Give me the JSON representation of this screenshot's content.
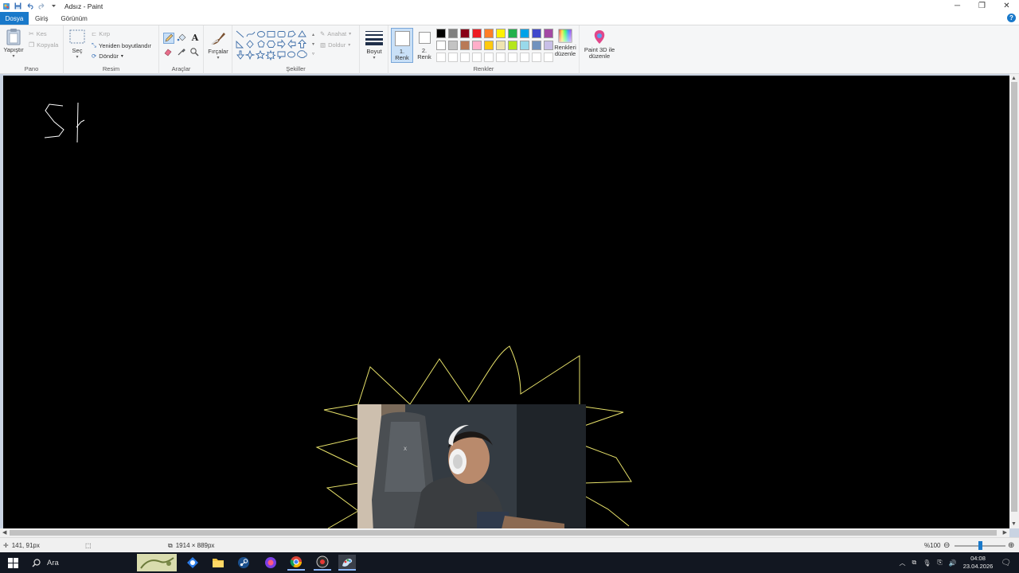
{
  "window": {
    "title": "Adsız - Paint",
    "minimize_glyph": "─",
    "maximize_glyph": "❐",
    "close_glyph": "✕"
  },
  "tabs": [
    {
      "label": "Dosya"
    },
    {
      "label": "Giriş"
    },
    {
      "label": "Görünüm"
    }
  ],
  "help": "?",
  "ribbon": {
    "pano": {
      "label": "Pano",
      "paste": "Yapıştır",
      "cut": "Kes",
      "copy": "Kopyala"
    },
    "resim": {
      "label": "Resim",
      "select": "Seç",
      "crop": "Kırp",
      "resize": "Yeniden boyutlandır",
      "rotate": "Döndür"
    },
    "araclar": {
      "label": "Araçlar"
    },
    "brushes": {
      "label": "Fırçalar"
    },
    "sekiller": {
      "label": "Şekiller",
      "outline": "Anahat",
      "fill": "Doldur"
    },
    "size": {
      "label": "Boyut"
    },
    "colors": {
      "label": "Renkler",
      "color1": "1. Renk",
      "color1_line1": "1.",
      "color1_line2": "Renk",
      "color2_line1": "2.",
      "color2_line2": "Renk",
      "edit_line1": "Renkleri",
      "edit_line2": "düzenle",
      "palette_row1": [
        "#000000",
        "#7f7f7f",
        "#880015",
        "#ed1c24",
        "#ff7f27",
        "#fff200",
        "#22b14c",
        "#00a2e8",
        "#3f48cc",
        "#a349a4"
      ],
      "palette_row2": [
        "#ffffff",
        "#c3c3c3",
        "#b97a57",
        "#ffaec9",
        "#ffc90e",
        "#efe4b0",
        "#b5e61d",
        "#99d9ea",
        "#7092be",
        "#c8bfe7"
      ],
      "palette_row3": [
        "#ffffff",
        "#ffffff",
        "#ffffff",
        "#ffffff",
        "#ffffff",
        "#ffffff",
        "#ffffff",
        "#ffffff",
        "#ffffff",
        "#ffffff"
      ]
    },
    "paint3d": {
      "line1": "Paint 3D ile",
      "line2": "düzenle"
    }
  },
  "canvas": {
    "background": "#000000",
    "drawing_color_sun": "#e8e26a",
    "drawing_color_text": "#ffffff"
  },
  "status": {
    "cursor_pos": "141, 91px",
    "canvas_size": "1914 × 889px",
    "zoom": "%100"
  },
  "taskbar": {
    "search_label": "Ara",
    "time": "04:08",
    "date": "23.04.2026",
    "accent": "#121721"
  }
}
